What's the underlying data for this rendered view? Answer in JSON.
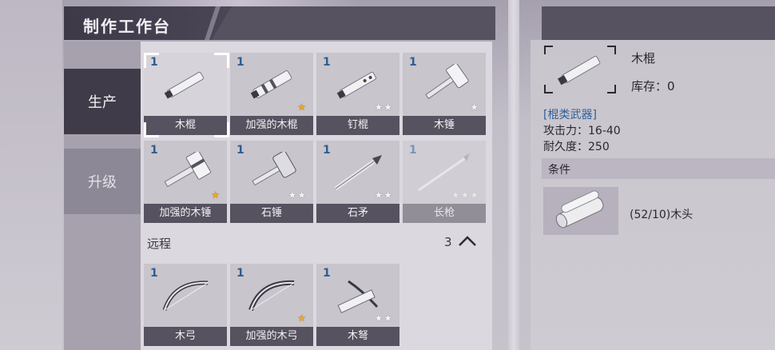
{
  "workbench": {
    "title": "制作工作台",
    "tabs": [
      {
        "label": "生产",
        "active": true
      },
      {
        "label": "升级",
        "active": false
      }
    ]
  },
  "grid": {
    "items": [
      {
        "count": "1",
        "name": "木棍",
        "stars": "",
        "icon": "wooden-stick-icon",
        "selected": true
      },
      {
        "count": "1",
        "name": "加强的木棍",
        "stars": "★",
        "star_type": "gold",
        "icon": "reinforced-stick-icon"
      },
      {
        "count": "1",
        "name": "钉棍",
        "stars": "★★",
        "icon": "spiked-club-icon"
      },
      {
        "count": "1",
        "name": "木锤",
        "stars": "★",
        "icon": "wooden-hammer-icon"
      },
      {
        "count": "1",
        "name": "加强的木锤",
        "stars": "★",
        "star_type": "gold",
        "icon": "reinforced-hammer-icon"
      },
      {
        "count": "1",
        "name": "石锤",
        "stars": "★★",
        "icon": "stone-hammer-icon"
      },
      {
        "count": "1",
        "name": "石矛",
        "stars": "★★",
        "icon": "stone-spear-icon"
      },
      {
        "count": "1",
        "name": "长枪",
        "stars": "★★★",
        "icon": "long-spear-icon",
        "locked": true
      }
    ],
    "ranged_section": {
      "label": "远程",
      "count": "3"
    },
    "ranged_items": [
      {
        "count": "1",
        "name": "木弓",
        "stars": "",
        "icon": "wooden-bow-icon"
      },
      {
        "count": "1",
        "name": "加强的木弓",
        "stars": "★",
        "star_type": "gold",
        "icon": "reinforced-bow-icon"
      },
      {
        "count": "1",
        "name": "木弩",
        "stars": "★★",
        "icon": "wooden-crossbow-icon"
      }
    ]
  },
  "detail": {
    "name": "木棍",
    "stock": "库存：0",
    "category": "[棍类武器]",
    "attack": "攻击力：16-40",
    "durability": "耐久度：250",
    "condition_label": "条件",
    "condition_item": "(52/10)木头",
    "condition_icon": "wood-log-icon"
  },
  "colors": {
    "accent_dark": "#57525f",
    "count_blue": "#2d5d92",
    "category_blue": "#2f5f95",
    "gold_star": "#e7a82a"
  }
}
